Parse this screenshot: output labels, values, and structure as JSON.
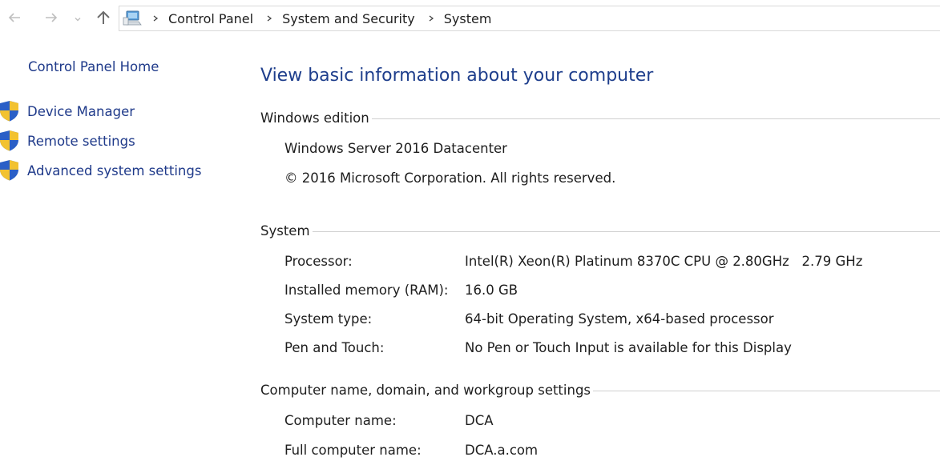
{
  "breadcrumb": [
    "Control Panel",
    "System and Security",
    "System"
  ],
  "left_nav": {
    "home": "Control Panel Home",
    "tasks": [
      "Device Manager",
      "Remote settings",
      "Advanced system settings"
    ]
  },
  "page_title": "View basic information about your computer",
  "windows_edition": {
    "header": "Windows edition",
    "edition": "Windows Server 2016 Datacenter",
    "copyright": "© 2016 Microsoft Corporation. All rights reserved."
  },
  "system": {
    "header": "System",
    "rows": [
      {
        "label": "Processor:",
        "value": "Intel(R) Xeon(R) Platinum 8370C CPU @ 2.80GHz   2.79 GHz"
      },
      {
        "label": "Installed memory (RAM):",
        "value": "16.0 GB"
      },
      {
        "label": "System type:",
        "value": "64-bit Operating System, x64-based processor"
      },
      {
        "label": "Pen and Touch:",
        "value": "No Pen or Touch Input is available for this Display"
      }
    ]
  },
  "computer_name": {
    "header": "Computer name, domain, and workgroup settings",
    "rows": [
      {
        "label": "Computer name:",
        "value": "DCA"
      },
      {
        "label": "Full computer name:",
        "value": "DCA.a.com"
      }
    ]
  },
  "icons": {
    "back": "arrow-left-icon",
    "forward": "arrow-right-icon",
    "recent": "chevron-down-icon",
    "up": "arrow-up-icon",
    "location": "computer-icon",
    "task": "uac-shield-icon"
  },
  "colors": {
    "link": "#1f3a8a",
    "title": "#1e3e8c",
    "shield_blue": "#2a5fc7",
    "shield_yellow": "#f2c230"
  }
}
